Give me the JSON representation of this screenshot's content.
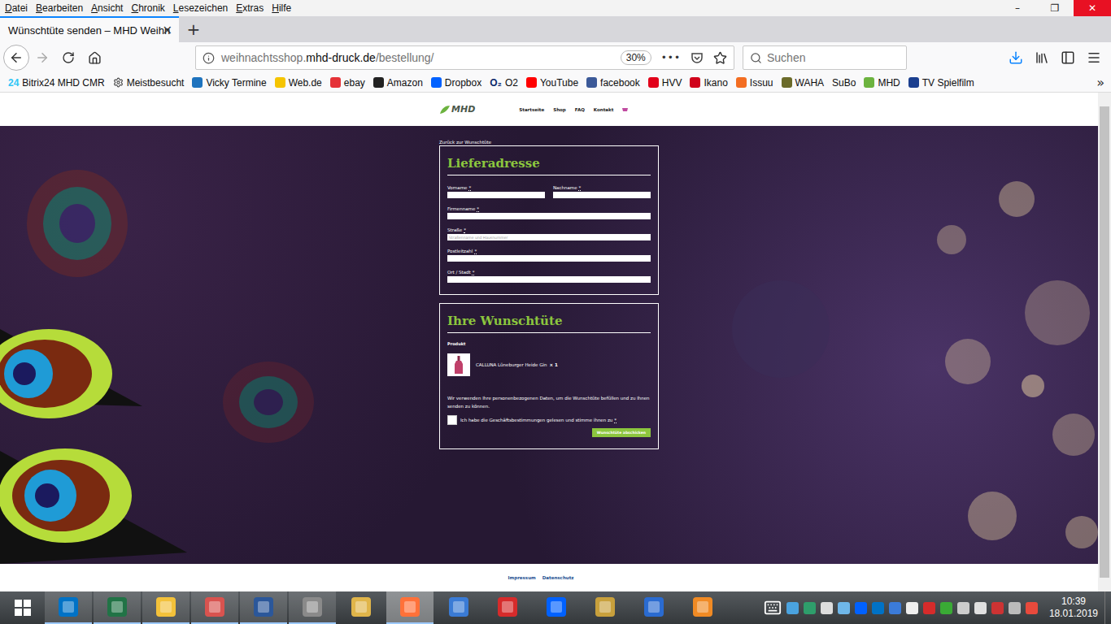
{
  "window": {
    "controls": [
      {
        "glyph": "–",
        "kind": "minimize"
      },
      {
        "glyph": "❐",
        "kind": "restore"
      },
      {
        "glyph": "✕",
        "kind": "close"
      }
    ]
  },
  "menu": [
    "Datei",
    "Bearbeiten",
    "Ansicht",
    "Chronik",
    "Lesezeichen",
    "Extras",
    "Hilfe"
  ],
  "tabs": [
    {
      "label": "Wünschtüte senden – MHD Weihn",
      "selected": true,
      "close": "×"
    }
  ],
  "new_tab": "+",
  "address_bar": {
    "subdomain": "weihnachtsshop.",
    "domain": "mhd-druck.de",
    "path": "/bestellung/",
    "zoom": "30%",
    "more": "•••"
  },
  "search": {
    "placeholder": "Suchen"
  },
  "bookmarks": {
    "items": [
      {
        "label": "Bitrix24 MHD CMR",
        "kind": "text",
        "icon_text": "24",
        "color": "#2fc6f6"
      },
      {
        "label": "Meistbesucht",
        "kind": "gear",
        "color": "#444444"
      },
      {
        "label": "Vicky Termine",
        "kind": "dot",
        "color": "#1e73be"
      },
      {
        "label": "Web.de",
        "kind": "dot",
        "color": "#f5c400"
      },
      {
        "label": "ebay",
        "kind": "dot",
        "color": "#e53238"
      },
      {
        "label": "Amazon",
        "kind": "dot",
        "color": "#222222"
      },
      {
        "label": "Dropbox",
        "kind": "dot",
        "color": "#0061ff"
      },
      {
        "label": "O2",
        "kind": "text",
        "icon_text": "O₂",
        "color": "#0a2a6b"
      },
      {
        "label": "YouTube",
        "kind": "dot",
        "color": "#ff0000"
      },
      {
        "label": "facebook",
        "kind": "dot",
        "color": "#3b5998"
      },
      {
        "label": "HVV",
        "kind": "dot",
        "color": "#e2001a"
      },
      {
        "label": "Ikano",
        "kind": "dot",
        "color": "#d0021b"
      },
      {
        "label": "Issuu",
        "kind": "dot",
        "color": "#f36d21"
      },
      {
        "label": "WAHA",
        "kind": "dot",
        "color": "#6b6b2a"
      },
      {
        "label": "SuBo",
        "kind": "none"
      },
      {
        "label": "MHD",
        "kind": "dot",
        "color": "#6cb33f"
      },
      {
        "label": "TV Spielfilm",
        "kind": "dot",
        "color": "#1b3f8f"
      }
    ],
    "overflow": "»"
  },
  "page": {
    "header": {
      "logo": "MHD",
      "nav": [
        "Startseite",
        "Shop",
        "FAQ",
        "Kontakt"
      ]
    },
    "back_link": "Zurück zur Wunschtüte",
    "address_form": {
      "title": "Lieferadresse",
      "required_mark": "*",
      "rows": [
        [
          {
            "label": "Vorname",
            "required": true
          },
          {
            "label": "Nachname",
            "required": true
          }
        ],
        [
          {
            "label": "Firmenname",
            "required": true
          }
        ],
        [
          {
            "label": "Straße",
            "required": true,
            "placeholder": "Straßenname und Hausnummer"
          }
        ],
        [
          {
            "label": "Postleitzahl",
            "required": true
          }
        ],
        [
          {
            "label": "Ort / Stadt",
            "required": true
          }
        ]
      ]
    },
    "cart": {
      "title": "Ihre Wunschtüte",
      "column": "Produkt",
      "items": [
        {
          "name": "CALLUNA Lüneburger Heide Gin",
          "quantity": "× 1"
        }
      ],
      "privacy_note": "Wir verwenden Ihre personenbezogenen Daten, um die Wunschtüte befüllen und zu Ihnen senden zu können.",
      "terms": {
        "label": "Ich habe die Geschäftsbestimmungen gelesen und stimme ihnen zu",
        "required": true,
        "checked": false
      },
      "submit": "Wunschtüte abschicken"
    },
    "footer": [
      "Impressum",
      "Datenschutz"
    ]
  },
  "taskbar": {
    "apps": [
      {
        "color": "#0072c6",
        "running": true,
        "selected": false
      },
      {
        "color": "#217346",
        "running": true,
        "selected": false
      },
      {
        "color": "#f3c13a",
        "running": true,
        "selected": false
      },
      {
        "color": "#d9534f",
        "running": true,
        "selected": false
      },
      {
        "color": "#2b579a",
        "running": true,
        "selected": false
      },
      {
        "color": "#8a8a8a",
        "running": true,
        "selected": false
      },
      {
        "color": "#e0b54a",
        "running": false,
        "selected": false
      },
      {
        "color": "#ff7139",
        "running": true,
        "selected": true
      },
      {
        "color": "#3a7bd5",
        "running": false,
        "selected": false
      },
      {
        "color": "#d62b2b",
        "running": false,
        "selected": false
      },
      {
        "color": "#0061ff",
        "running": false,
        "selected": false
      },
      {
        "color": "#c8a03c",
        "running": false,
        "selected": false
      },
      {
        "color": "#2a6bd1",
        "running": false,
        "selected": false
      },
      {
        "color": "#f08a24",
        "running": false,
        "selected": false
      }
    ],
    "tray": [
      "#4aa3df",
      "#2e9e6b",
      "#dddddd",
      "#6fb7e9",
      "#0061ff",
      "#0072c6",
      "#3b7bd9",
      "#eeeeee",
      "#d62b2b",
      "#3aaa35",
      "#cccccc",
      "#e0e0e0",
      "#cc3333",
      "#bbbbbb",
      "#e84a3c"
    ],
    "time": "10:39",
    "date": "18.01.2019"
  }
}
